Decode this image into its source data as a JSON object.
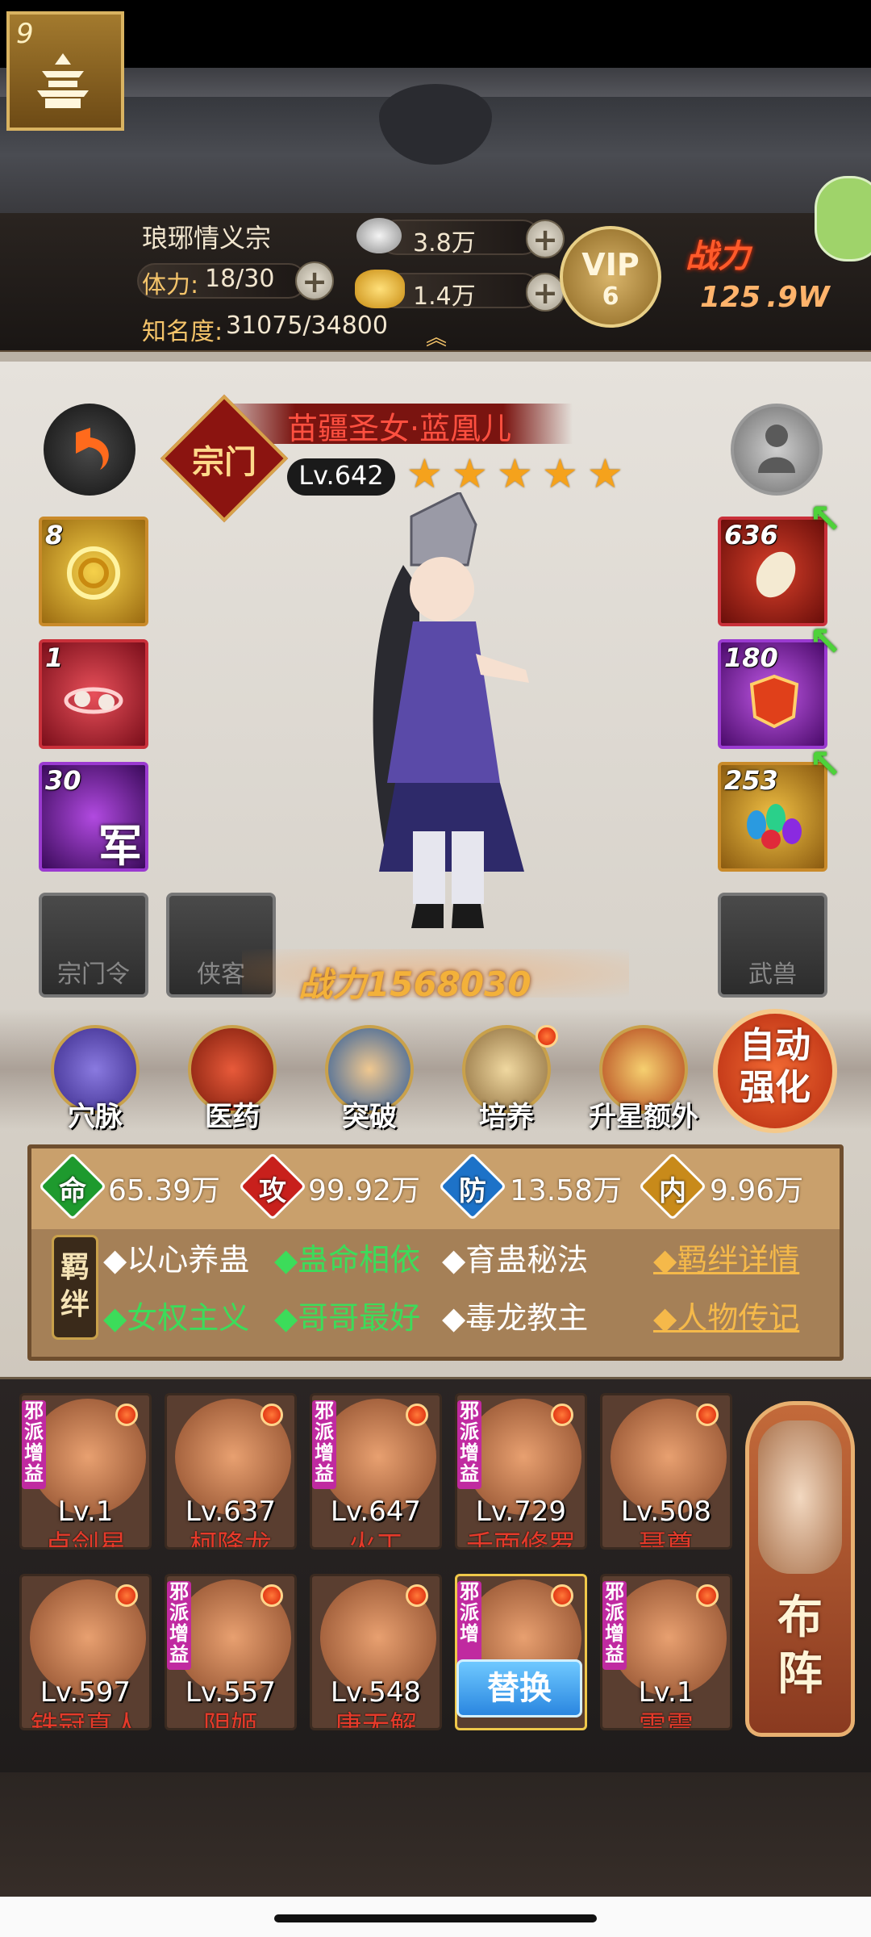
{
  "hud": {
    "sect_level": "9",
    "sect_name": "琅琊情义宗",
    "stamina_label": "体力:",
    "stamina_value": "18/30",
    "fame_label": "知名度:",
    "fame_value": "31075/34800",
    "silver": "3.8万",
    "gold": "1.4万",
    "vip_label": "VIP",
    "vip_level": "6",
    "power_label": "战力",
    "power_value": "125 .9W"
  },
  "hero": {
    "name": "苗疆圣女·蓝凰儿",
    "seal": "宗门",
    "level": "Lv.642",
    "stars": 5,
    "power": "战力1568030"
  },
  "left_slots": [
    {
      "count": "8",
      "icon": "gold-swirl-icon"
    },
    {
      "count": "1",
      "icon": "skull-orbit-icon"
    },
    {
      "count": "30",
      "icon": "army-flag-icon",
      "badge": "军"
    }
  ],
  "right_slots": [
    {
      "count": "636",
      "icon": "silkworm-icon"
    },
    {
      "count": "180",
      "icon": "armor-icon"
    },
    {
      "count": "253",
      "icon": "gems-icon"
    }
  ],
  "empty_slots": [
    "宗门令",
    "侠客",
    "武兽"
  ],
  "functions": [
    {
      "label": "穴脉",
      "icon": "meridian-icon",
      "dot": false
    },
    {
      "label": "医药",
      "icon": "herb-icon",
      "dot": false
    },
    {
      "label": "突破",
      "icon": "breakthrough-icon",
      "dot": false
    },
    {
      "label": "培养",
      "icon": "scroll-icon",
      "dot": true
    },
    {
      "label": "升星额外",
      "icon": "star-up-icon",
      "dot": false
    }
  ],
  "auto_button": "自动强化",
  "stats": [
    {
      "glyph": "命",
      "value": "65.39万",
      "color": "#1e9a2e"
    },
    {
      "glyph": "攻",
      "value": "99.92万",
      "color": "#c8201c"
    },
    {
      "glyph": "防",
      "value": "13.58万",
      "color": "#1d72c8"
    },
    {
      "glyph": "内",
      "value": "9.96万",
      "color": "#c88a1a"
    }
  ],
  "bond_tag": "羁绊",
  "bonds_row1": [
    {
      "text": "◆以心养蛊",
      "style": "white"
    },
    {
      "text": "◆蛊命相依",
      "style": "green"
    },
    {
      "text": "◆育蛊秘法",
      "style": "white"
    }
  ],
  "bonds_row2": [
    {
      "text": "◆女权主义",
      "style": "green"
    },
    {
      "text": "◆哥哥最好",
      "style": "green"
    },
    {
      "text": "◆毒龙教主",
      "style": "white"
    }
  ],
  "bond_links": [
    "◆羁绊详情",
    "◆人物传记"
  ],
  "roster_row1": [
    {
      "level": "Lv.1",
      "name": "卢剑星",
      "tag": "邪派增益"
    },
    {
      "level": "Lv.637",
      "name": "柯降龙",
      "tag": ""
    },
    {
      "level": "Lv.647",
      "name": "火工",
      "tag": "邪派增益"
    },
    {
      "level": "Lv.729",
      "name": "千面修罗",
      "tag": "邪派增益"
    },
    {
      "level": "Lv.508",
      "name": "聂尊",
      "tag": ""
    }
  ],
  "roster_row2": [
    {
      "level": "Lv.597",
      "name": "铁冠真人",
      "tag": ""
    },
    {
      "level": "Lv.557",
      "name": "阴姬",
      "tag": "邪派增益"
    },
    {
      "level": "Lv.548",
      "name": "唐无解",
      "tag": ""
    },
    {
      "level": "",
      "name": "",
      "tag": "邪派增"
    },
    {
      "level": "Lv.1",
      "name": "雷震",
      "tag": "邪派增益"
    }
  ],
  "swap_button": "替换",
  "formation_button": "布阵"
}
